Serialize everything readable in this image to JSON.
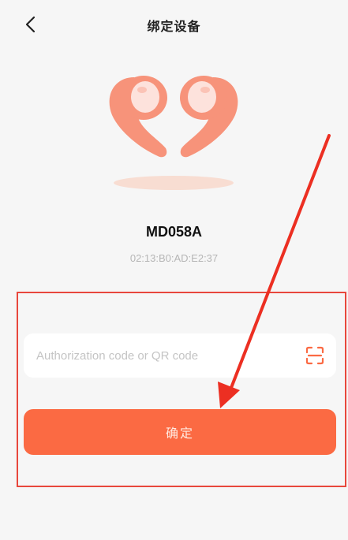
{
  "header": {
    "title": "绑定设备",
    "back_icon": "chevron-left-icon"
  },
  "device": {
    "image_icon": "open-ear-earbuds-icon",
    "name": "MD058A",
    "mac": "02:13:B0:AD:E2:37"
  },
  "bind_form": {
    "code_input": {
      "value": "",
      "placeholder": "Authorization code or QR code"
    },
    "scan_icon": "scan-qr-icon",
    "confirm_label": "确定"
  },
  "colors": {
    "accent": "#fb6a43",
    "earbud": "#f7937a",
    "earbud_inner": "#fde2dc",
    "annotation": "#e8473c",
    "background": "#f6f6f6"
  }
}
